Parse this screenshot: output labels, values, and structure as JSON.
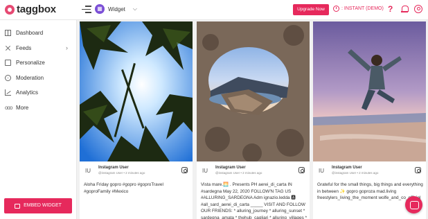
{
  "header": {
    "logo_text": "taggbox",
    "widget_label": "Widget",
    "upgrade_label": "Upgrade Now",
    "plan_label": ": INSTANT (DEMO)",
    "help_label": "?",
    "accent_color": "#e6295c"
  },
  "sidebar": {
    "items": [
      {
        "label": "Dashboard",
        "icon": "dashboard-icon"
      },
      {
        "label": "Feeds",
        "icon": "feeds-icon"
      },
      {
        "label": "Personalize",
        "icon": "personalize-icon"
      },
      {
        "label": "Moderation",
        "icon": "moderation-icon"
      },
      {
        "label": "Analytics",
        "icon": "analytics-icon"
      },
      {
        "label": "More",
        "icon": "more-icon"
      }
    ],
    "feeds_chevron": "›",
    "more_dots": "ooo",
    "embed_label": "EMBED WIDGET"
  },
  "posts": [
    {
      "avatar": "IU",
      "user": "Instagram User",
      "handle": "@instagram User • 2 minutes ago",
      "caption": "Aloha Friday gopro #gopro #goproTravel #goproFamily #Mexico"
    },
    {
      "avatar": "IU",
      "user": "Instagram User",
      "handle": "@instagram User • 2 minutes ago",
      "caption": "Vista mare.🌅 . Presents PH aerei_di_carta IN #sardegna May 22, 2020 FOLLOW'N TAG US #ALLURING_SARDEGNA Adm ignazio.ledda 🅰 #all_sard_aerei_di_carta _____ VISIT AND FOLLOW OUR FRIENDS: * alluring_journey * alluring_sunset * sardegna_amata * thehub_cagliari * alluring_villages * alluring_islands"
    },
    {
      "avatar": "IU",
      "user": "Instagram User",
      "handle": "@instagram User • 2 minutes ago",
      "caption": "Grateful for the small things, big things and everything in between ✨ gopro goproza mad.living freestylers_living_the_moment wolfe_and_co_official"
    }
  ]
}
